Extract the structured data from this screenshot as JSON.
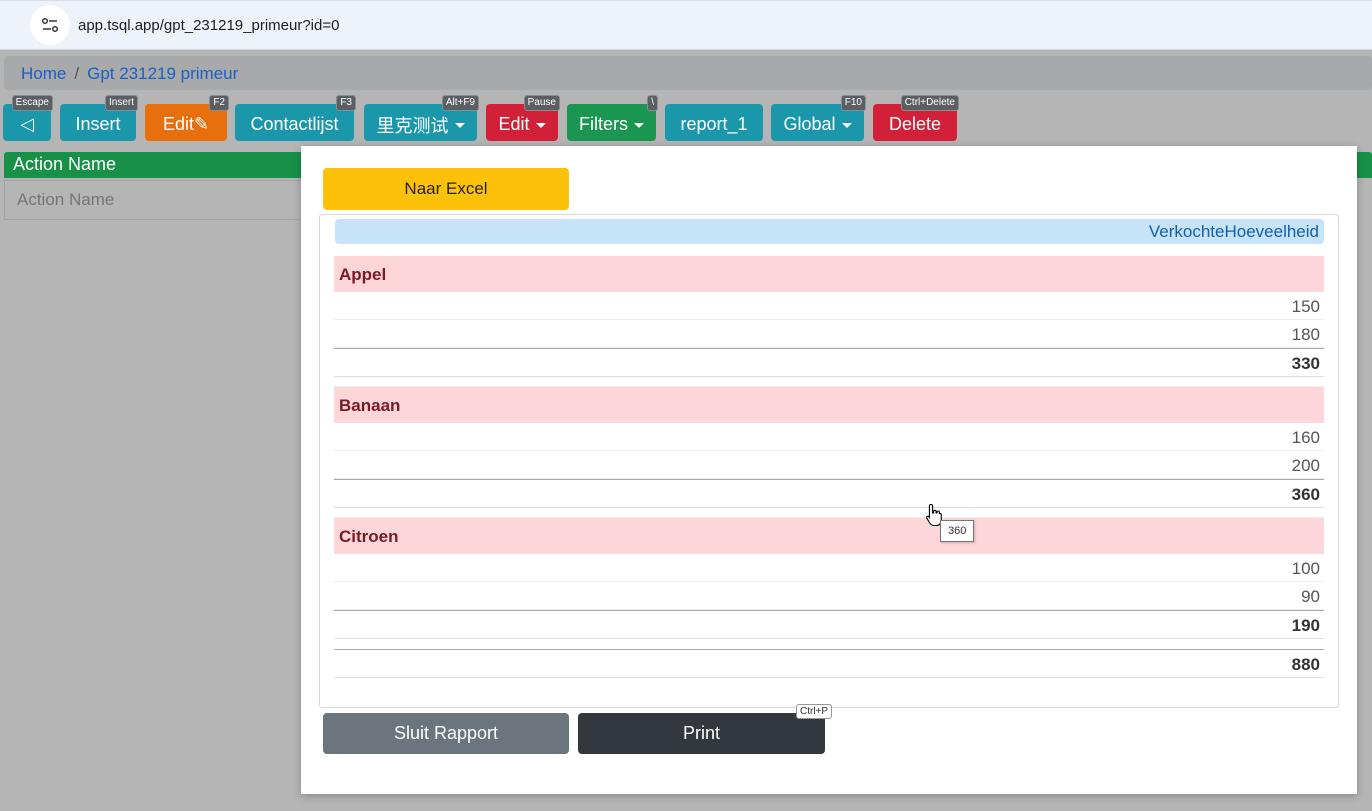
{
  "browser": {
    "url": "app.tsql.app/gpt_231219_primeur?id=0",
    "site_icon": "tune-icon"
  },
  "breadcrumb": {
    "home": "Home",
    "separator": "/",
    "current": "Gpt 231219 primeur"
  },
  "toolbar": {
    "back": {
      "label": "◁",
      "shortcut": "Escape"
    },
    "insert": {
      "label": "Insert",
      "shortcut": "Insert"
    },
    "edit_pen": {
      "label": "Edit✎",
      "shortcut": "F2"
    },
    "contactlijst": {
      "label": "Contactlijst",
      "shortcut": "F3"
    },
    "chinese": {
      "label": "里克测试",
      "shortcut": "Alt+F9"
    },
    "edit_menu": {
      "label": "Edit",
      "shortcut": "Pause"
    },
    "filters": {
      "label": "Filters",
      "shortcut": "\\"
    },
    "report": {
      "label": "report_1"
    },
    "global": {
      "label": "Global",
      "shortcut": "F10"
    },
    "delete": {
      "label": "Delete",
      "shortcut": "Ctrl+Delete"
    }
  },
  "action_table": {
    "header": "Action Name",
    "input_placeholder": "Action Name"
  },
  "modal": {
    "excel_button": "Naar Excel",
    "column_header": "VerkochteHoeveelheid",
    "groups": [
      {
        "name": "Appel",
        "values": [
          "150",
          "180"
        ],
        "total": "330"
      },
      {
        "name": "Banaan",
        "values": [
          "160",
          "200"
        ],
        "total": "360"
      },
      {
        "name": "Citroen",
        "values": [
          "100",
          "90"
        ],
        "total": "190"
      }
    ],
    "grand_total": "880",
    "close_button": "Sluit Rapport",
    "print_button": "Print",
    "print_shortcut": "Ctrl+P"
  },
  "tooltip": {
    "text": "360"
  },
  "colors": {
    "teal": "#1a97ab",
    "orange": "#e86f0e",
    "red": "#d12038",
    "green": "#1a9650",
    "yellow": "#fec109",
    "group_bg": "#fdd6da"
  }
}
